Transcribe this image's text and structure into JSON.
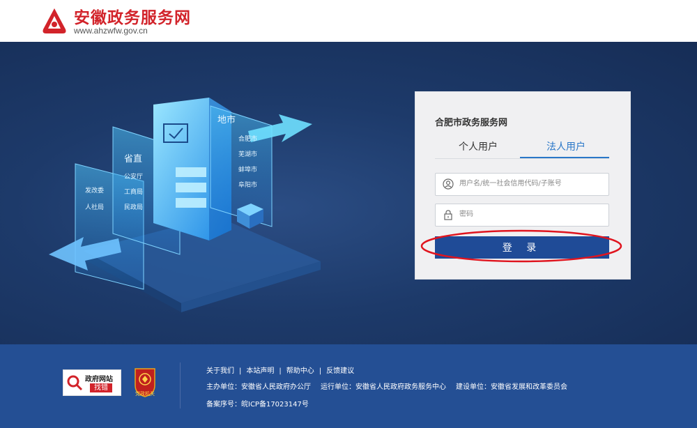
{
  "header": {
    "site_name": "安徽政务服务网",
    "domain": "www.ahzwfw.gov.cn"
  },
  "hero": {
    "illustration": {
      "panel_city_title": "地市",
      "panel_city_items": [
        "合肥市",
        "芜湖市",
        "蚌埠市",
        "阜阳市"
      ],
      "panel_province_title": "省直",
      "panel_province_items": [
        "公安厅",
        "工商局",
        "民政局"
      ],
      "panel_left_items": [
        "发改委",
        "人社局"
      ]
    }
  },
  "login": {
    "title": "合肥市政务服务网",
    "tabs": [
      {
        "label": "个人用户",
        "active": false
      },
      {
        "label": "法人用户",
        "active": true
      }
    ],
    "username_placeholder": "用户名/统一社会信用代码/子账号",
    "password_placeholder": "密码",
    "submit_label": "登 录"
  },
  "footer": {
    "badge_find_line1": "政府网站",
    "badge_find_line2": "找错",
    "badge_party_label": "党政机关",
    "links": [
      "关于我们",
      "本站声明",
      "帮助中心",
      "反馈建议"
    ],
    "host": "主办单位：安徽省人民政府办公厅",
    "operator": "运行单位：安徽省人民政府政务服务中心",
    "builder": "建设单位：安徽省发展和改革委员会",
    "icp": "备案序号：皖ICP备17023147号"
  },
  "colors": {
    "brand_red": "#d2232a",
    "hero_blue": "#1d3a6a",
    "button_blue": "#1f4b97",
    "tab_active": "#2a77c8",
    "footer_blue": "#244f94",
    "annotation_red": "#e0141e"
  },
  "icons": {
    "logo": "ahzwfw-logo-icon",
    "user": "user-icon",
    "lock": "lock-icon",
    "magnifier": "magnifier-icon",
    "party_emblem": "party-emblem-icon"
  }
}
